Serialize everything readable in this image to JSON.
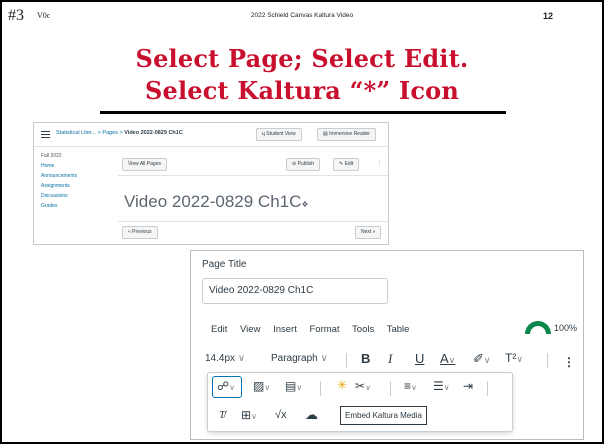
{
  "slide": {
    "number": "#3",
    "version": "V0c",
    "source": "2022 Schield Canvas Kaltura Video",
    "page": "12",
    "title_line1": "Select Page; Select Edit.",
    "title_line2": "Select Kaltura “*” Icon",
    "title_color": "#c8102e"
  },
  "canvas_page": {
    "breadcrumb_course": "Statistical Liter...",
    "breadcrumb_sep1": ">",
    "breadcrumb_pages": "Pages",
    "breadcrumb_sep2": ">",
    "breadcrumb_current": "Video 2022-0829 Ch1C",
    "student_view": "ц Student View",
    "immersive_reader": "Immersive Reader",
    "view_all_pages": "View All Pages",
    "publish": "Publish",
    "edit": "Edit",
    "more": "⋮",
    "sidebar": [
      "Fall 2022",
      "Home",
      "Announcements",
      "Assignments",
      "Discussions",
      "Grades"
    ],
    "video_title": "Video 2022-0829 Ch1C",
    "previous": "« Previous",
    "next": "Next »",
    "link_color": "#0770a3"
  },
  "editor": {
    "page_title_label": "Page Title",
    "page_title_value": "Video 2022-0829 Ch1C",
    "menu": [
      "Edit",
      "View",
      "Insert",
      "Format",
      "Tools",
      "Table"
    ],
    "score_percent": "100%",
    "score_color": "#0b874b",
    "font_size": "14.4px",
    "paragraph": "Paragraph",
    "bold": "B",
    "italic": "I",
    "underline": "U",
    "font_color": "A",
    "highlight": "✐",
    "superscript": "T²",
    "chev": "∨",
    "more": "⋮",
    "link_icon": "☍",
    "image_icon": "▨",
    "doc_icon": "▤",
    "kaltura_icon": "✳",
    "media_icon": "✂",
    "align_icon": "≡",
    "list_icon": "☰",
    "indent_icon": "⇥",
    "clear_format_icon": "T̸",
    "table_icon": "⊞",
    "equation_icon": "√x",
    "cloud_icon": "☁",
    "tooltip": "Embed Kaltura Media"
  }
}
